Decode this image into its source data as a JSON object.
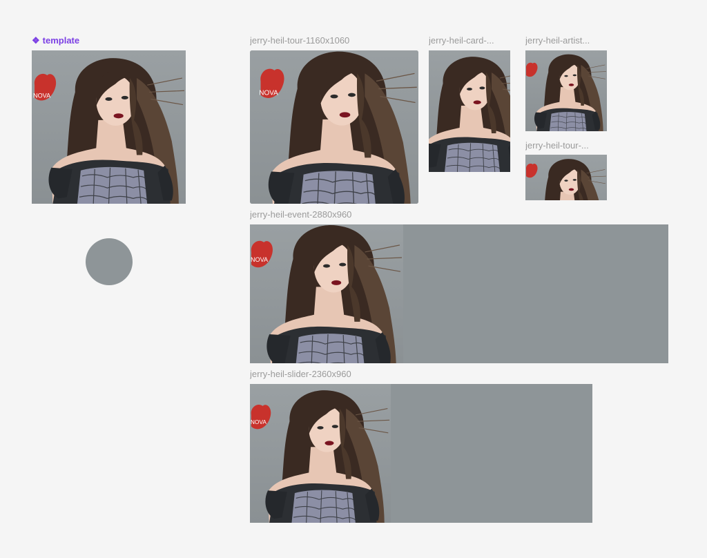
{
  "canvas": {
    "background": "#f5f5f5",
    "frame_fill": "#8e9598"
  },
  "component": {
    "icon": "component-diamond-icon",
    "label": "template",
    "color": "#7b3fe4"
  },
  "frames": [
    {
      "id": "tour-large",
      "label": "jerry-heil-tour-1160x1060"
    },
    {
      "id": "card",
      "label": "jerry-heil-card-..."
    },
    {
      "id": "artist",
      "label": "jerry-heil-artist..."
    },
    {
      "id": "tour-small",
      "label": "jerry-heil-tour-..."
    },
    {
      "id": "event",
      "label": "jerry-heil-event-2880x960"
    },
    {
      "id": "slider",
      "label": "jerry-heil-slider-2360x960"
    }
  ],
  "artwork": {
    "badge_text": "NOVA",
    "badge_color": "#c8322c"
  }
}
